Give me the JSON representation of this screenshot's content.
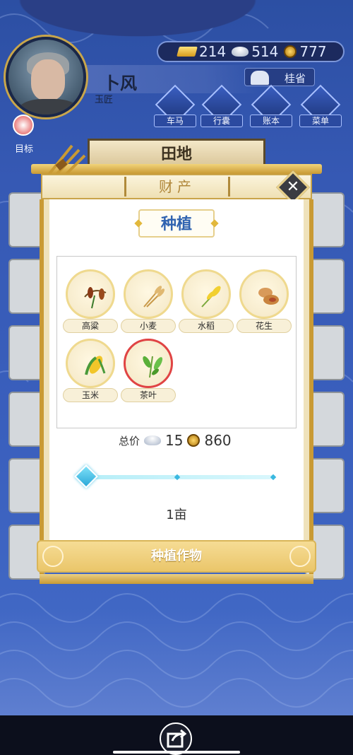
{
  "player": {
    "name": "卜风",
    "title": "玉匠"
  },
  "currency": {
    "gold": "214",
    "silver": "514",
    "coins": "777"
  },
  "region": "桂省",
  "nav": {
    "carriage": "车马",
    "luggage": "行囊",
    "ledger": "账本",
    "menu": "菜单",
    "goal": "目标"
  },
  "field_banner": "田地",
  "modal": {
    "header": "财产",
    "close_symbol": "✕",
    "section_title": "种植",
    "crops": [
      {
        "label": "高粱",
        "icon": "sorghum-icon"
      },
      {
        "label": "小麦",
        "icon": "wheat-icon"
      },
      {
        "label": "水稻",
        "icon": "rice-icon"
      },
      {
        "label": "花生",
        "icon": "peanut-icon"
      },
      {
        "label": "玉米",
        "icon": "corn-icon"
      },
      {
        "label": "茶叶",
        "icon": "tea-icon"
      }
    ],
    "selected_crop": "茶叶",
    "price_label": "总价",
    "price_silver": "15",
    "price_coins": "860",
    "slider_fraction": 0.0,
    "amount": "1亩",
    "plant_button": "种植作物"
  },
  "colors": {
    "background_blue": "#3659b4",
    "gold_accent": "#c99a34",
    "title_blue": "#2f63b0",
    "selected_red": "#e04444"
  }
}
